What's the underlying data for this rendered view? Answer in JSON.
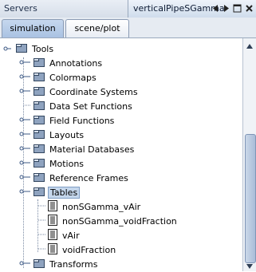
{
  "header": {
    "left_label": "Servers",
    "title": "verticalPipeSGamma"
  },
  "tabs": [
    {
      "label": "simulation"
    },
    {
      "label": "scene/plot"
    }
  ],
  "tree": {
    "root": "Tools",
    "items": [
      "Annotations",
      "Colormaps",
      "Coordinate Systems",
      "Data Set Functions",
      "Field Functions",
      "Layouts",
      "Material Databases",
      "Motions",
      "Reference Frames",
      "Tables",
      "Transforms"
    ],
    "table_children": [
      "nonSGamma_vAir",
      "nonSGamma_voidFraction",
      "vAir",
      "voidFraction"
    ]
  },
  "icons": {
    "folder": "folder-icon",
    "table": "table-icon"
  }
}
